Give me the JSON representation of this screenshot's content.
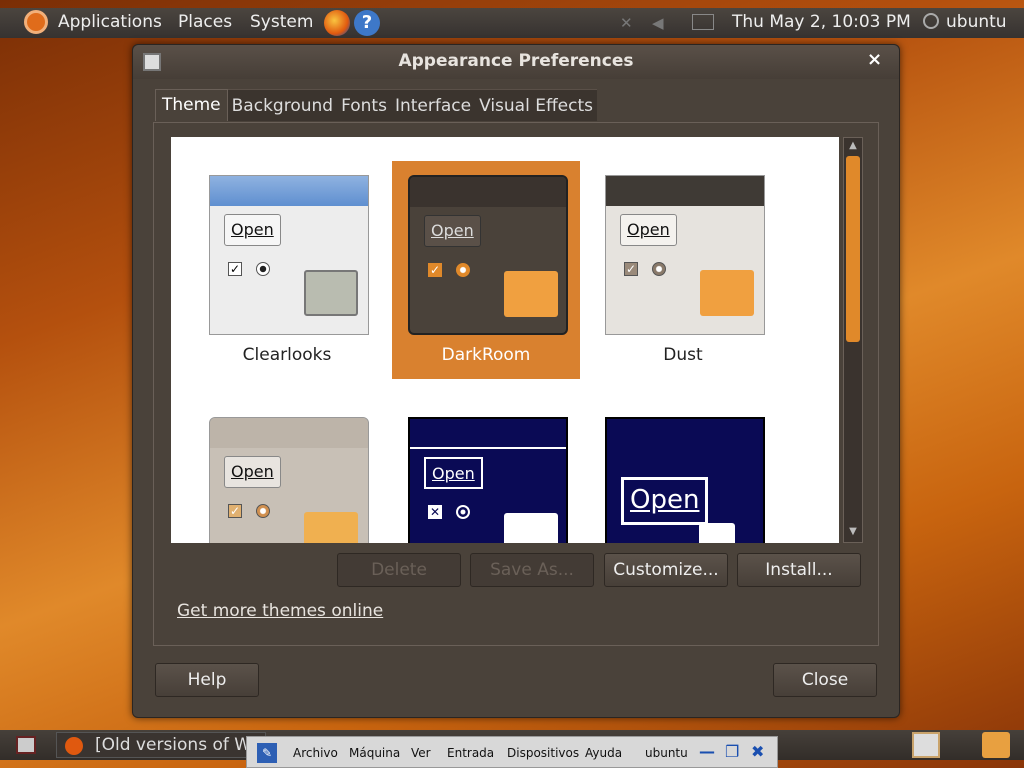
{
  "top_panel": {
    "menus": [
      "Applications",
      "Places",
      "System"
    ],
    "clock": "Thu May  2, 10:03 PM",
    "user": "ubuntu"
  },
  "window": {
    "title": "Appearance Preferences",
    "close_glyph": "×",
    "tabs": [
      "Theme",
      "Background",
      "Fonts",
      "Interface",
      "Visual Effects"
    ],
    "active_tab": "Theme",
    "themes": [
      {
        "name": "Clearlooks",
        "selected": false
      },
      {
        "name": "DarkRoom",
        "selected": true
      },
      {
        "name": "Dust",
        "selected": false
      },
      {
        "name": "",
        "selected": false
      },
      {
        "name": "",
        "selected": false
      },
      {
        "name": "",
        "selected": false
      }
    ],
    "preview_open_label": "Open",
    "buttons": {
      "delete": "Delete",
      "save_as": "Save As...",
      "customize": "Customize...",
      "install": "Install...",
      "help": "Help",
      "close": "Close"
    },
    "more_link": "Get more themes online"
  },
  "bottom_panel": {
    "task_firefox": "[Old versions of Wi"
  },
  "vbox_bar": {
    "menus": [
      "Archivo",
      "Máquina",
      "Ver",
      "Entrada",
      "Dispositivos",
      "Ayuda"
    ],
    "vm_name": "ubuntu"
  },
  "colors": {
    "accent": "#d9812f",
    "window_bg": "#4a423a"
  }
}
